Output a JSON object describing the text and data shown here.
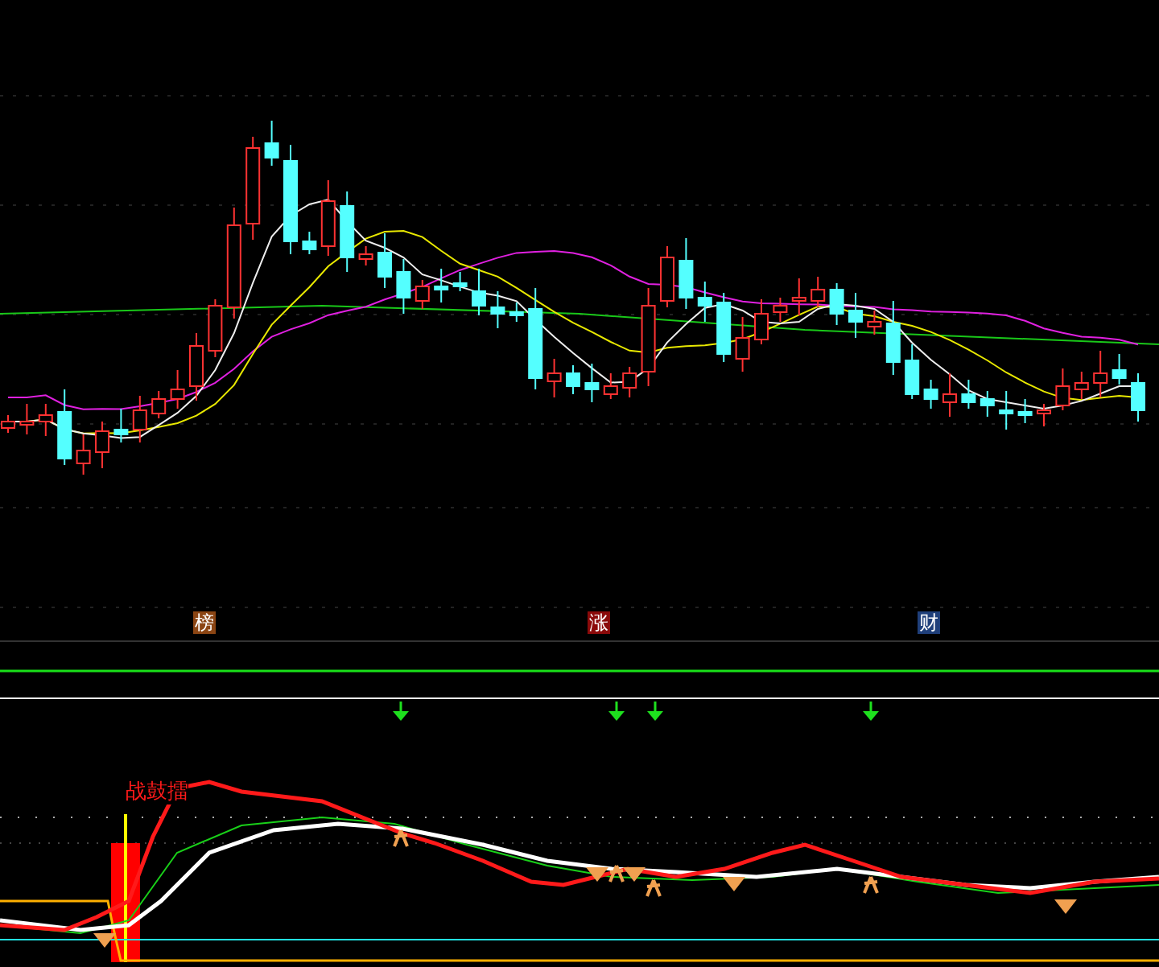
{
  "event_tags": [
    {
      "label": "榜",
      "color": "#8b4513"
    },
    {
      "label": "涨",
      "color": "#8b0a0a"
    },
    {
      "label": "财",
      "color": "#1f3f7a"
    }
  ],
  "signal_label": "战鼓擂"
}
